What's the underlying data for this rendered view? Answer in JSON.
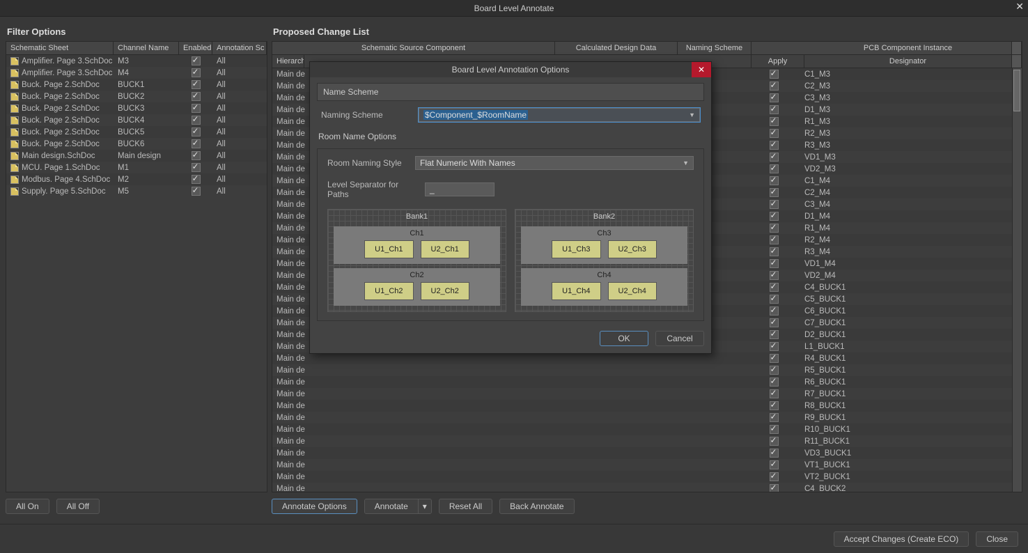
{
  "window": {
    "title": "Board Level Annotate"
  },
  "leftPanel": {
    "title": "Filter Options",
    "headers": [
      "Schematic Sheet",
      "Channel Name",
      "Enabled",
      "Annotation Sc"
    ],
    "rows": [
      {
        "sheet": "Amplifier. Page 3.SchDoc",
        "chan": "M3",
        "ann": "All"
      },
      {
        "sheet": "Amplifier. Page 3.SchDoc",
        "chan": "M4",
        "ann": "All"
      },
      {
        "sheet": "Buck. Page 2.SchDoc",
        "chan": "BUCK1",
        "ann": "All"
      },
      {
        "sheet": "Buck. Page 2.SchDoc",
        "chan": "BUCK2",
        "ann": "All"
      },
      {
        "sheet": "Buck. Page 2.SchDoc",
        "chan": "BUCK3",
        "ann": "All"
      },
      {
        "sheet": "Buck. Page 2.SchDoc",
        "chan": "BUCK4",
        "ann": "All"
      },
      {
        "sheet": "Buck. Page 2.SchDoc",
        "chan": "BUCK5",
        "ann": "All"
      },
      {
        "sheet": "Buck. Page 2.SchDoc",
        "chan": "BUCK6",
        "ann": "All"
      },
      {
        "sheet": "Main design.SchDoc",
        "chan": "Main design",
        "ann": "All"
      },
      {
        "sheet": "MCU. Page 1.SchDoc",
        "chan": "M1",
        "ann": "All"
      },
      {
        "sheet": "Modbus. Page 4.SchDoc",
        "chan": "M2",
        "ann": "All"
      },
      {
        "sheet": "Supply. Page 5.SchDoc",
        "chan": "M5",
        "ann": "All"
      }
    ],
    "buttons": {
      "allOn": "All On",
      "allOff": "All Off"
    }
  },
  "rightPanel": {
    "title": "Proposed Change List",
    "headers": {
      "schematicSource": "Schematic Source Component",
      "calculated": "Calculated Design Data",
      "naming": "Naming Scheme",
      "pcb": "PCB Component Instance",
      "hierarchy": "Hierarch",
      "apply": "Apply",
      "designator": "Designator"
    },
    "leftRepeat": "Main de",
    "designators": [
      "C1_M3",
      "C2_M3",
      "C3_M3",
      "D1_M3",
      "R1_M3",
      "R2_M3",
      "R3_M3",
      "VD1_M3",
      "VD2_M3",
      "C1_M4",
      "C2_M4",
      "C3_M4",
      "D1_M4",
      "R1_M4",
      "R2_M4",
      "R3_M4",
      "VD1_M4",
      "VD2_M4",
      "C4_BUCK1",
      "C5_BUCK1",
      "C6_BUCK1",
      "C7_BUCK1",
      "D2_BUCK1",
      "L1_BUCK1",
      "R4_BUCK1",
      "R5_BUCK1",
      "R6_BUCK1",
      "R7_BUCK1",
      "R8_BUCK1",
      "R9_BUCK1",
      "R10_BUCK1",
      "R11_BUCK1",
      "VD3_BUCK1",
      "VT1_BUCK1",
      "VT2_BUCK1",
      "C4_BUCK2"
    ],
    "buttons": {
      "annotateOptions": "Annotate Options",
      "annotate": "Annotate",
      "resetAll": "Reset All",
      "backAnnotate": "Back Annotate"
    }
  },
  "bottom": {
    "accept": "Accept Changes (Create ECO)",
    "close": "Close"
  },
  "modal": {
    "title": "Board Level Annotation Options",
    "nameSchemeHeader": "Name Scheme",
    "namingSchemeLabel": "Naming Scheme",
    "namingSchemeValue": "$Component_$RoomName",
    "roomOptionsHeader": "Room Name Options",
    "roomStyleLabel": "Room Naming Style",
    "roomStyleValue": "Flat Numeric With Names",
    "levelSepLabel": "Level Separator for Paths",
    "levelSepValue": "_",
    "banks": [
      {
        "name": "Bank1",
        "channels": [
          {
            "name": "Ch1",
            "chips": [
              "U1_Ch1",
              "U2_Ch1"
            ]
          },
          {
            "name": "Ch2",
            "chips": [
              "U1_Ch2",
              "U2_Ch2"
            ]
          }
        ]
      },
      {
        "name": "Bank2",
        "channels": [
          {
            "name": "Ch3",
            "chips": [
              "U1_Ch3",
              "U2_Ch3"
            ]
          },
          {
            "name": "Ch4",
            "chips": [
              "U1_Ch4",
              "U2_Ch4"
            ]
          }
        ]
      }
    ],
    "ok": "OK",
    "cancel": "Cancel"
  }
}
